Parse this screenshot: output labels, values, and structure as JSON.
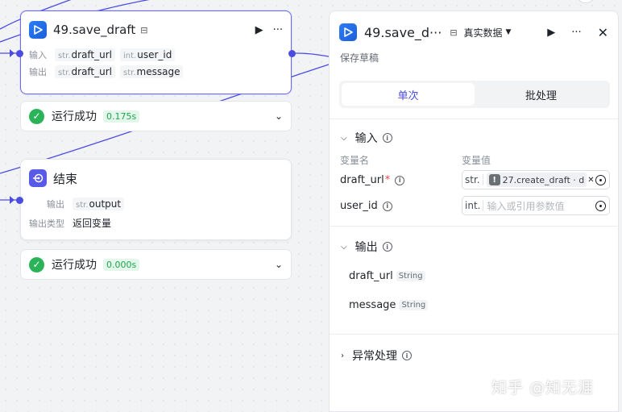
{
  "canvas": {
    "save_node": {
      "title": "49.save_draft",
      "title_mark": "⊟",
      "input_label": "输入",
      "output_label": "输出",
      "inputs": [
        {
          "type": "str.",
          "name": "draft_url"
        },
        {
          "type": "int.",
          "name": "user_id"
        }
      ],
      "outputs": [
        {
          "type": "str.",
          "name": "draft_url"
        },
        {
          "type": "str.",
          "name": "message"
        }
      ]
    },
    "save_status": {
      "text": "运行成功",
      "time": "0.175s"
    },
    "end_node": {
      "title": "结束",
      "output_label": "输出",
      "output": {
        "type": "str.",
        "name": "output"
      },
      "output_type_label": "输出类型",
      "output_type_value": "返回变量"
    },
    "end_status": {
      "text": "运行成功",
      "time": "0.000s"
    }
  },
  "panel": {
    "title": "49.save_d···",
    "title_mark": "⊟",
    "data_mode": "真实数据",
    "subtitle": "保存草稿",
    "tabs": [
      {
        "label": "单次",
        "active": true
      },
      {
        "label": "批处理",
        "active": false
      }
    ],
    "input_section": {
      "title": "输入",
      "col_name": "变量名",
      "col_value": "变量值",
      "vars": [
        {
          "name": "draft_url",
          "required": "*",
          "type": "str.",
          "ref": "27.create_draft · d",
          "placeholder": ""
        },
        {
          "name": "user_id",
          "required": "",
          "type": "int.",
          "ref": "",
          "placeholder": "输入或引用参数值"
        }
      ]
    },
    "output_section": {
      "title": "输出",
      "items": [
        {
          "name": "draft_url",
          "type": "String"
        },
        {
          "name": "message",
          "type": "String"
        }
      ]
    },
    "exception_section": {
      "title": "异常处理"
    }
  },
  "watermark": "知乎 @知无涯",
  "colors": {
    "accent": "#4b4ce0",
    "success": "#2bb35a",
    "node_blue": "#2a7cf6"
  }
}
